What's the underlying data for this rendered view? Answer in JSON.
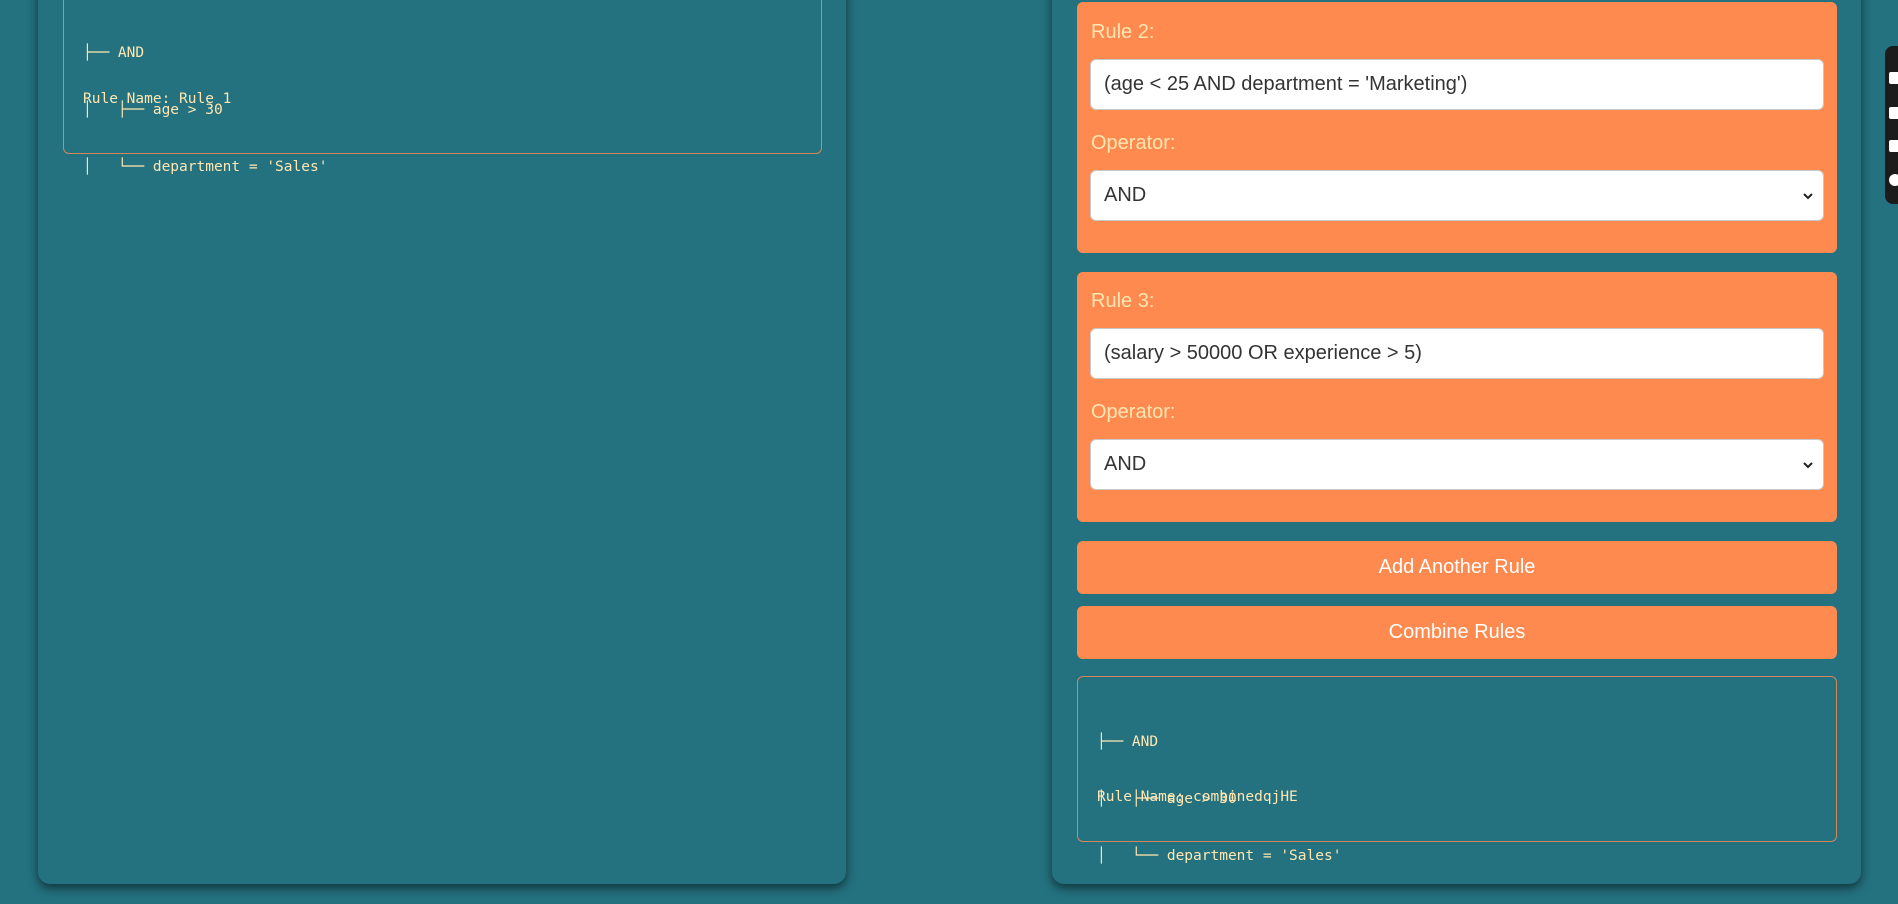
{
  "left_panel": {
    "tree_lines": [
      "├── AND",
      "│   ├── age > 30",
      "│   └── department = 'Sales'"
    ],
    "rule_name": "Rule Name: Rule 1"
  },
  "right_panel": {
    "rules": [
      {
        "label": "Rule 2:",
        "value": "(age < 25 AND department = 'Marketing')",
        "operator_label": "Operator:",
        "operator_value": "AND"
      },
      {
        "label": "Rule 3:",
        "value": "(salary > 50000 OR experience > 5)",
        "operator_label": "Operator:",
        "operator_value": "AND"
      }
    ],
    "add_button": "Add Another Rule",
    "combine_button": "Combine Rules",
    "result": {
      "tree_lines": [
        "├── AND",
        "│   ├── age > 30",
        "│   └── department = 'Sales'"
      ],
      "rule_name": "Rule Name: combinedqjHE"
    }
  },
  "colors": {
    "background": "#24717f",
    "accent": "#ff8a50",
    "label_text": "#ffe6b0",
    "border": "#d4875a"
  },
  "toolbar_icons": [
    "checkbox-icon",
    "square-icon",
    "copy-icon",
    "gear-icon"
  ]
}
